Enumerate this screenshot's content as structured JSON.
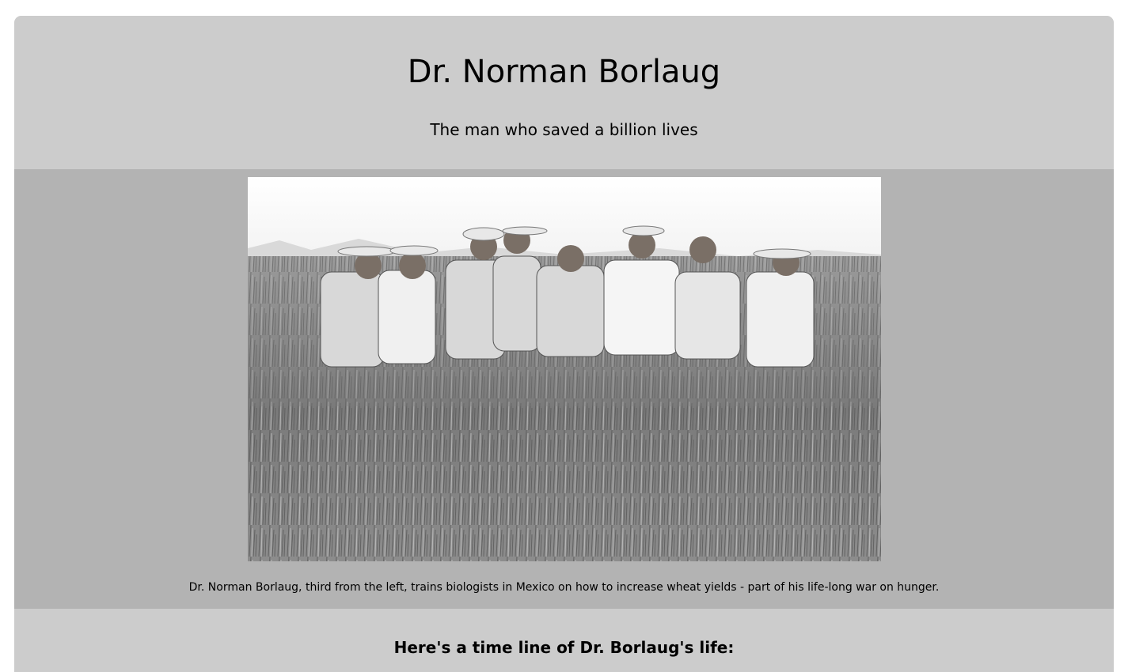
{
  "header": {
    "title": "Dr. Norman Borlaug",
    "subtitle": "The man who saved a billion lives"
  },
  "image": {
    "alt": "Dr. Norman Borlaug, third from the left, trains biologists in Mexico on how to increase wheat yields - part of his life-long war on hunger.",
    "caption": "Dr. Norman Borlaug, third from the left, trains biologists in Mexico on how to increase wheat yields - part of his life-long war on hunger."
  },
  "tribute": {
    "heading": "Here's a time line of Dr. Borlaug's life:"
  },
  "colors": {
    "page_background": "#ffffff",
    "main_background": "#cccccc",
    "image_section_background": "#b3b3b3"
  }
}
